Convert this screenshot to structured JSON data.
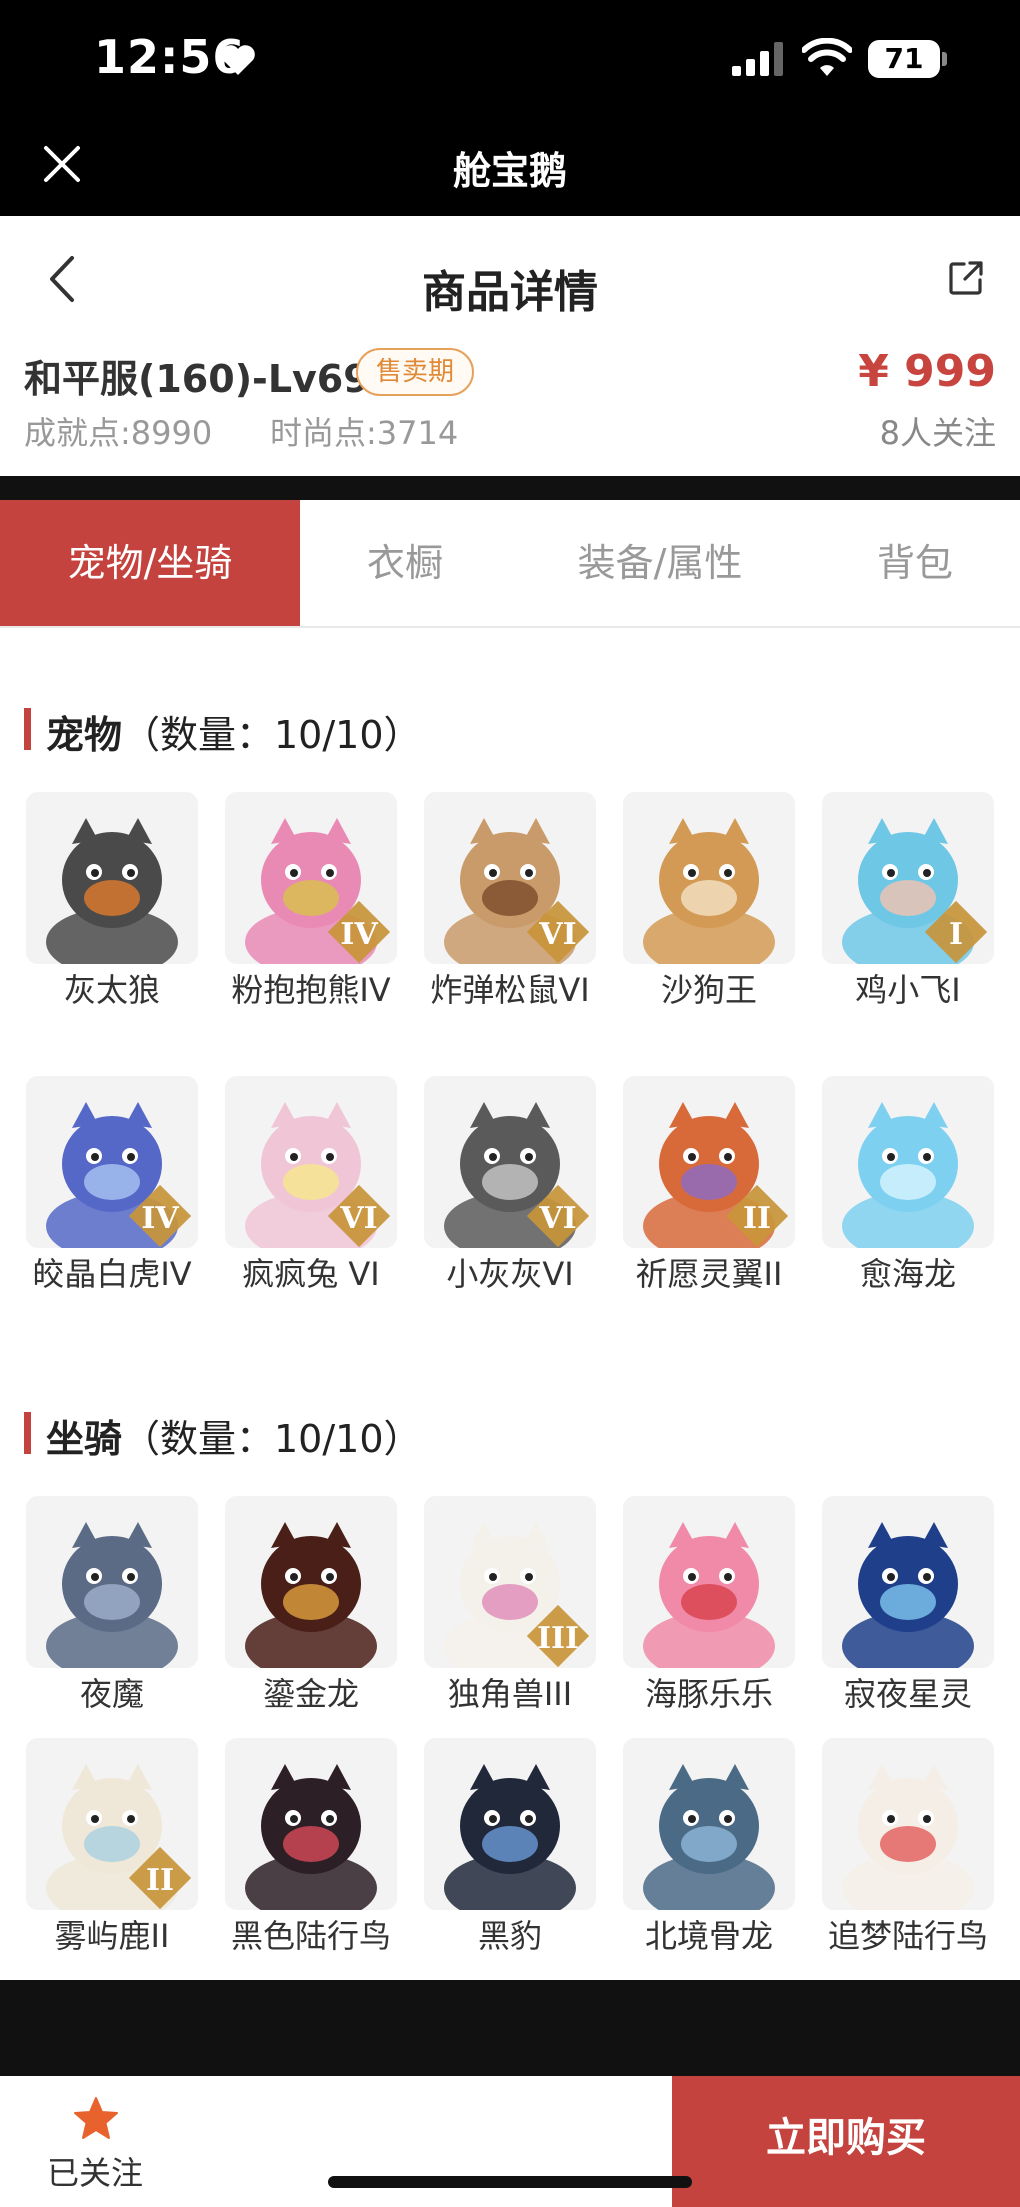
{
  "status_bar": {
    "time": "12:56",
    "battery": "71"
  },
  "app_bar": {
    "title": "舱宝鹅"
  },
  "nav": {
    "title": "商品详情"
  },
  "product": {
    "name": "和平服(160)-Lv69",
    "badge": "售卖期",
    "price": "¥ 999",
    "stats": [
      "成就点:8990",
      "时尚点:3714"
    ],
    "followers": "8人关注"
  },
  "tabs": [
    {
      "label": "宠物/坐骑",
      "active": true
    },
    {
      "label": "衣橱",
      "active": false
    },
    {
      "label": "装备/属性",
      "active": false
    },
    {
      "label": "背包",
      "active": false
    }
  ],
  "sections": [
    {
      "title": "宠物",
      "count": "（数量：10/10）",
      "items": [
        {
          "name": "灰太狼",
          "icon": "grey-wolf-icon",
          "bg": "#f3f3f3",
          "fg": "#4a4a4a",
          "accent": "#e07b2c",
          "tier": ""
        },
        {
          "name": "粉抱抱熊IV",
          "icon": "pink-bear-icon",
          "bg": "#f3f3f3",
          "fg": "#e98ab5",
          "accent": "#d8c24a",
          "tier": "IV"
        },
        {
          "name": "炸弹松鼠VI",
          "icon": "bomb-squirrel-icon",
          "bg": "#f3f3f3",
          "fg": "#c99a6a",
          "accent": "#7c4a2b",
          "tier": "VI"
        },
        {
          "name": "沙狗王",
          "icon": "shiba-dog-icon",
          "bg": "#f3f3f3",
          "fg": "#d39a55",
          "accent": "#f4e2c5",
          "tier": ""
        },
        {
          "name": "鸡小飞I",
          "icon": "chick-icon",
          "bg": "#f3f3f3",
          "fg": "#6fc7e6",
          "accent": "#f2c3b0",
          "tier": "I"
        },
        {
          "name": "皎晶白虎IV",
          "icon": "white-tiger-icon",
          "bg": "#f3f3f3",
          "fg": "#5568c8",
          "accent": "#a9c4f2",
          "tier": "IV"
        },
        {
          "name": "疯疯兔 VI",
          "icon": "rabbit-icon",
          "bg": "#f3f3f3",
          "fg": "#f0c6d6",
          "accent": "#f6e78a",
          "tier": "VI"
        },
        {
          "name": "小灰灰VI",
          "icon": "little-wolf-icon",
          "bg": "#f3f3f3",
          "fg": "#5a5a5a",
          "accent": "#c9c9c9",
          "tier": "VI"
        },
        {
          "name": "祈愿灵翼II",
          "icon": "spirit-eagle-icon",
          "bg": "#f3f3f3",
          "fg": "#d86a3a",
          "accent": "#8a6ac9",
          "tier": "II"
        },
        {
          "name": "愈海龙",
          "icon": "sea-dragon-icon",
          "bg": "#f3f3f3",
          "fg": "#7ed0f0",
          "accent": "#d8f4ff",
          "tier": ""
        }
      ]
    },
    {
      "title": "坐骑",
      "count": "（数量：10/10）",
      "items": [
        {
          "name": "夜魔",
          "icon": "night-demon-horse-icon",
          "bg": "#f3f3f3",
          "fg": "#5b6b86",
          "accent": "#9fb2cc",
          "tier": ""
        },
        {
          "name": "鎏金龙",
          "icon": "golden-dragon-icon",
          "bg": "#f3f3f3",
          "fg": "#4a1f18",
          "accent": "#e0a040",
          "tier": ""
        },
        {
          "name": "独角兽III",
          "icon": "unicorn-icon",
          "bg": "#f3f3f3",
          "fg": "#f4f0ea",
          "accent": "#e08ab8",
          "tier": "III"
        },
        {
          "name": "海豚乐乐",
          "icon": "dolphin-icon",
          "bg": "#f3f3f3",
          "fg": "#f08aa8",
          "accent": "#d8404a",
          "tier": ""
        },
        {
          "name": "寂夜星灵",
          "icon": "star-spirit-icon",
          "bg": "#f3f3f3",
          "fg": "#1f3f8a",
          "accent": "#7ec8f0",
          "tier": ""
        },
        {
          "name": "雾屿鹿II",
          "icon": "deer-icon",
          "bg": "#f3f3f3",
          "fg": "#efe8d8",
          "accent": "#a8d0e0",
          "tier": "II"
        },
        {
          "name": "黑色陆行鸟",
          "icon": "black-chocobo-icon",
          "bg": "#f3f3f3",
          "fg": "#2c1f26",
          "accent": "#d84a5a",
          "tier": ""
        },
        {
          "name": "黑豹",
          "icon": "black-panther-icon",
          "bg": "#f3f3f3",
          "fg": "#20283a",
          "accent": "#6a9ad8",
          "tier": ""
        },
        {
          "name": "北境骨龙",
          "icon": "bone-dragon-icon",
          "bg": "#f3f3f3",
          "fg": "#4a6a86",
          "accent": "#8fb8d8",
          "tier": ""
        },
        {
          "name": "追梦陆行鸟",
          "icon": "dream-chocobo-icon",
          "bg": "#f3f3f3",
          "fg": "#f4eee6",
          "accent": "#e25a5a",
          "tier": ""
        }
      ]
    }
  ],
  "bottom": {
    "follow_label": "已关注",
    "buy_label": "立即购买"
  },
  "colors": {
    "accent": "#c4433f",
    "price": "#c8453f",
    "badge": "#e08a37"
  }
}
